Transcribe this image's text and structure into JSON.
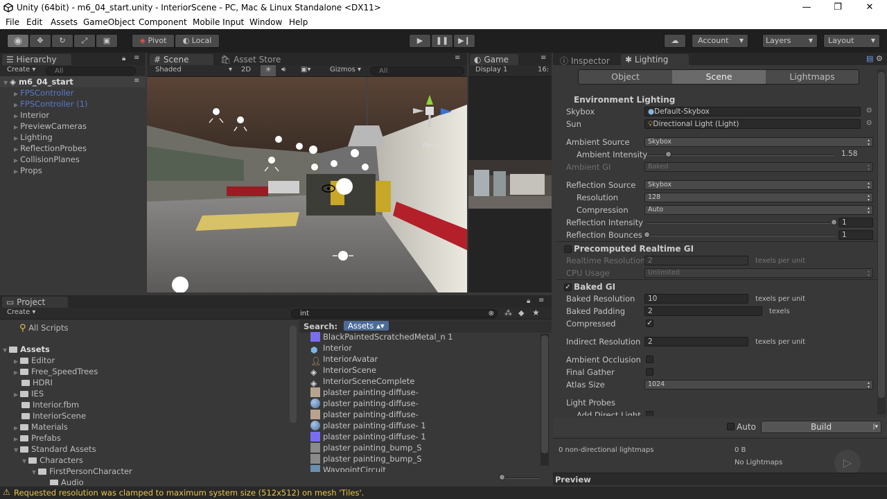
{
  "window": {
    "title": "Unity (64bit) - m6_04_start.unity - InteriorScene - PC, Mac & Linux Standalone <DX11>",
    "minimize": "—",
    "maximize": "❐",
    "close": "✕"
  },
  "menu": [
    "File",
    "Edit",
    "Assets",
    "GameObject",
    "Component",
    "Mobile Input",
    "Window",
    "Help"
  ],
  "toolbar": {
    "pivot": "Pivot",
    "local": "Local",
    "account": "Account",
    "layers": "Layers",
    "layout": "Layout"
  },
  "hierarchy": {
    "tab": "Hierarchy",
    "create": "Create",
    "search_placeholder": "All",
    "scene": "m6_04_start",
    "items": [
      "FPSController",
      "FPSController (1)",
      "Interior",
      "PreviewCameras",
      "Lighting",
      "ReflectionProbes",
      "CollisionPlanes",
      "Props"
    ]
  },
  "scene_view": {
    "tab": "Scene",
    "tab2": "Asset Store",
    "shading": "Shaded",
    "mode2d": "2D",
    "gizmos": "Gizmos",
    "search_placeholder": "All",
    "persp": "Persp"
  },
  "game_view": {
    "tab": "Game",
    "display": "Display 1",
    "aspect": "16:"
  },
  "project": {
    "tab": "Project",
    "create": "Create",
    "search_value": "int",
    "favorites": [
      "All Scripts"
    ],
    "search_label": "Search:",
    "search_scope": "Assets",
    "tree": [
      "Assets",
      "Editor",
      "Free_SpeedTrees",
      "HDRI",
      "IES",
      "Interior.fbm",
      "InteriorScene",
      "Materials",
      "Prefabs",
      "Standard Assets",
      "Characters",
      "FirstPersonCharacter",
      "Audio"
    ],
    "results": [
      "BlackPaintedScratchedMetal_n 1",
      "Interior",
      "InteriorAvatar",
      "InteriorScene",
      "InteriorSceneComplete",
      "plaster painting-diffuse-",
      "plaster painting-diffuse-",
      "plaster painting-diffuse-",
      "plaster painting-diffuse- 1",
      "plaster painting-diffuse- 1",
      "plaster painting_bump_S",
      "plaster painting_bump_S",
      "WaypointCircuit"
    ]
  },
  "inspector": {
    "tab": "Inspector",
    "lighting_tab": "Lighting",
    "subtabs": [
      "Object",
      "Scene",
      "Lightmaps"
    ],
    "env_header": "Environment Lighting",
    "skybox_label": "Skybox",
    "skybox_value": "Default-Skybox",
    "sun_label": "Sun",
    "sun_value": "Directional Light (Light)",
    "ambient_source_label": "Ambient Source",
    "ambient_source_value": "Skybox",
    "ambient_intensity_label": "Ambient Intensity",
    "ambient_intensity_value": "1.58",
    "ambient_intensity": 0.58,
    "ambient_gi_label": "Ambient GI",
    "ambient_gi_value": "Baked",
    "reflection_source_label": "Reflection Source",
    "reflection_source_value": "Skybox",
    "resolution_label": "Resolution",
    "resolution_value": "128",
    "compression_label": "Compression",
    "compression_value": "Auto",
    "reflection_intensity_label": "Reflection Intensity",
    "reflection_intensity_value": "1",
    "reflection_intensity": 1.0,
    "reflection_bounces_label": "Reflection Bounces",
    "reflection_bounces_value": "1",
    "reflection_bounces": 0.0,
    "precomputed_header": "Precomputed Realtime GI",
    "realtime_res_label": "Realtime Resolution",
    "realtime_res_value": "2",
    "texels_per_unit": "texels per unit",
    "cpu_usage_label": "CPU Usage",
    "cpu_usage_value": "Unlimited",
    "baked_header": "Baked GI",
    "baked_res_label": "Baked Resolution",
    "baked_res_value": "10",
    "baked_padding_label": "Baked Padding",
    "baked_padding_value": "2",
    "texels": "texels",
    "compressed_label": "Compressed",
    "indirect_res_label": "Indirect Resolution",
    "indirect_res_value": "2",
    "ao_label": "Ambient Occlusion",
    "final_gather_label": "Final Gather",
    "atlas_label": "Atlas Size",
    "atlas_value": "1024",
    "light_probes_label": "Light Probes",
    "add_direct_label": "Add Direct Light",
    "auto_label": "Auto",
    "build_label": "Build",
    "lightmaps_count": "0 non-directional lightmaps",
    "size": "0 B",
    "no_lightmaps": "No Lightmaps",
    "preview": "Preview"
  },
  "status": {
    "message": "Requested resolution was clamped to maximum system size (512x512) on mesh 'Tiles'."
  }
}
